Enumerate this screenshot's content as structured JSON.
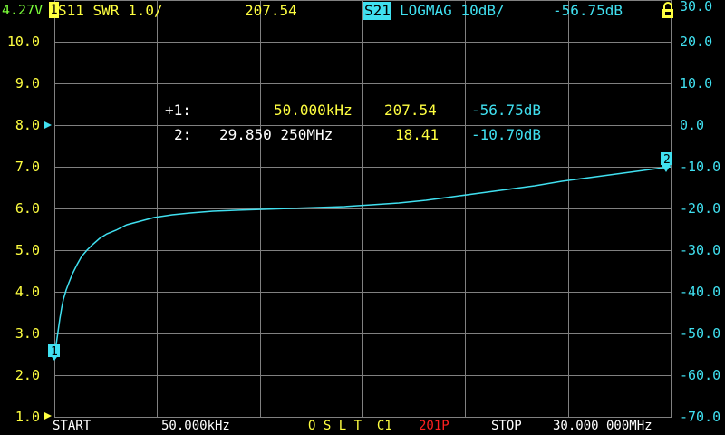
{
  "header": {
    "battery": "4.27V",
    "ch0_marker": "1",
    "ch0_format": "S11 SWR 1.0/",
    "ch0_value": "207.54",
    "ch1_label": "S21",
    "ch1_format": "LOGMAG 10dB/",
    "ch1_value": "-56.75dB",
    "lock_icon": "lock-icon"
  },
  "left_axis": {
    "ticks": [
      "10.0",
      "9.0",
      "8.0",
      "7.0",
      "6.0",
      "5.0",
      "4.0",
      "3.0",
      "2.0",
      "1.0"
    ]
  },
  "right_axis": {
    "ticks": [
      "30.0",
      "20.0",
      "10.0",
      "0.0",
      "-10.0",
      "-20.0",
      "-30.0",
      "-40.0",
      "-50.0",
      "-60.0",
      "-70.0"
    ]
  },
  "markers": {
    "m1": {
      "label": "+1:",
      "freq": "50.000kHz",
      "value1": "207.54",
      "value2": "-56.75dB"
    },
    "m2": {
      "label": "2:",
      "freq": "29.850 250MHz",
      "value1": "18.41",
      "value2": "-10.70dB"
    }
  },
  "trace_markers": [
    "1",
    "2"
  ],
  "footer": {
    "start_label": "START",
    "start_value": "50.000kHz",
    "cal_status": "O S L T  C1",
    "points": "201P",
    "stop_label": "STOP",
    "stop_value": "30.000 000MHz"
  },
  "colors": {
    "ch0": "#ffff40",
    "ch1": "#40e0f0",
    "grid": "#808080",
    "points": "#ff2020"
  }
}
